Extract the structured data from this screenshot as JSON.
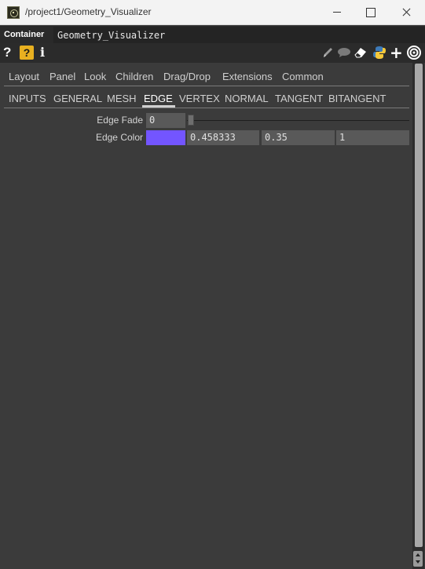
{
  "window": {
    "title": "/project1/Geometry_Visualizer",
    "app_icon": "touchdesigner-app-icon"
  },
  "header": {
    "op_type": "Container",
    "op_name": "Geometry_Visualizer"
  },
  "toolbar": {
    "help": "?",
    "help2": "?",
    "info": "i",
    "plus": "+"
  },
  "page_tabs": [
    "Layout",
    "Panel",
    "Look",
    "Children",
    "Drag/Drop",
    "Extensions",
    "Common"
  ],
  "custom_tabs": [
    "INPUTS",
    "GENERAL",
    "MESH",
    "EDGE",
    "VERTEX",
    "NORMAL",
    "TANGENT",
    "BITANGENT"
  ],
  "active_custom_tab": "EDGE",
  "params": {
    "edge_fade": {
      "label": "Edge Fade",
      "value": "0"
    },
    "edge_color": {
      "label": "Edge Color",
      "swatch_color": "#7355ff",
      "r": "0.458333",
      "g": "0.35",
      "b": "1"
    }
  },
  "colors": {
    "background": "#3b3b3b",
    "header": "#2a2a2a",
    "field": "#595959",
    "accent_help": "#e8b020"
  }
}
